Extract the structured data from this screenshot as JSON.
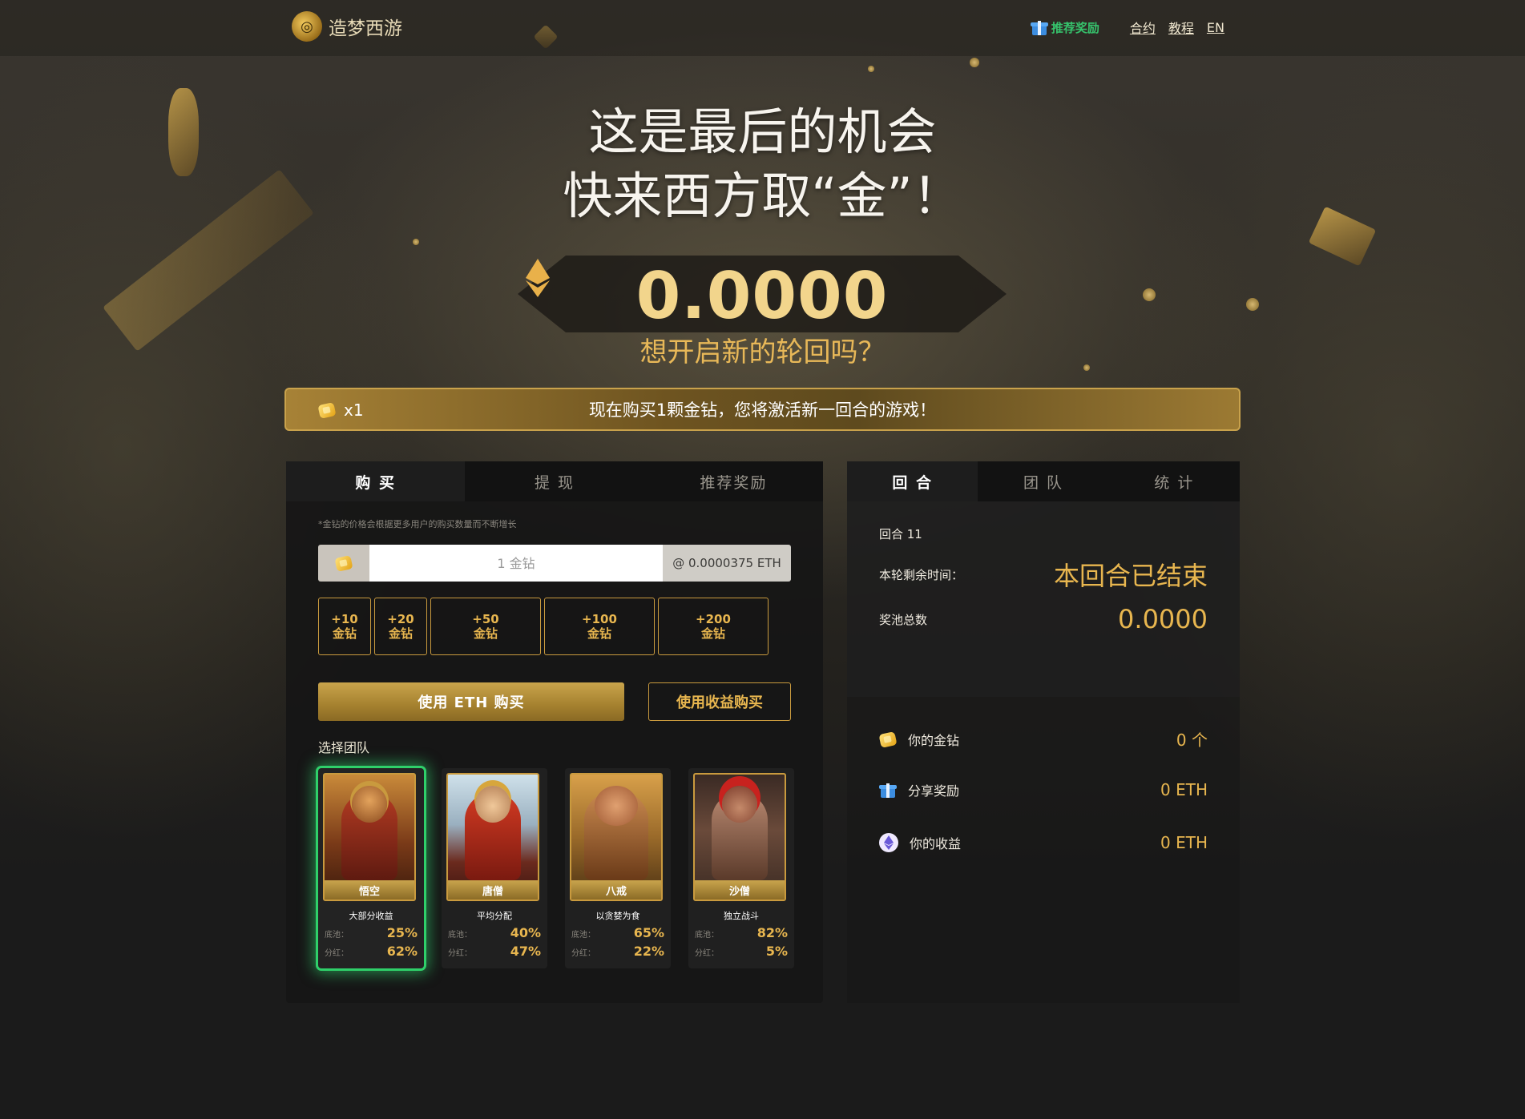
{
  "header": {
    "logo_text": "造梦西游",
    "referral_link": "推荐奖励",
    "nav": [
      "合约",
      "教程",
      "EN"
    ]
  },
  "hero": {
    "line1": "这是最后的机会",
    "line2": "快来西方取“金”！",
    "pot_value": "0.0000",
    "subtitle": "想开启新的轮回吗？"
  },
  "notice_bar": {
    "count": "x1",
    "message": "现在购买1颗金钻，您将激活新一回合的游戏！"
  },
  "left_panel": {
    "tabs": [
      "购 买",
      "提 现",
      "推荐奖励"
    ],
    "active_tab": 0,
    "note": "*金钻的价格会根据更多用户的购买数量而不断增长",
    "input_placeholder": "1 金钻",
    "input_price": "@ 0.0000375 ETH",
    "quick_buttons": [
      {
        "amount": "+10",
        "unit": "金钻"
      },
      {
        "amount": "+20",
        "unit": "金钻"
      },
      {
        "amount": "+50",
        "unit": "金钻"
      },
      {
        "amount": "+100",
        "unit": "金钻"
      },
      {
        "amount": "+200",
        "unit": "金钻"
      }
    ],
    "buy_eth_label": "使用 ETH 购买",
    "buy_earnings_label": "使用收益购买",
    "team_label": "选择团队",
    "teams": [
      {
        "name": "悟空",
        "desc": "大部分收益",
        "pool_label": "底池：",
        "pool": "25%",
        "div_label": "分红：",
        "div": "62%",
        "selected": true
      },
      {
        "name": "唐僧",
        "desc": "平均分配",
        "pool_label": "底池：",
        "pool": "40%",
        "div_label": "分红：",
        "div": "47%",
        "selected": false
      },
      {
        "name": "八戒",
        "desc": "以贪婪为食",
        "pool_label": "底池：",
        "pool": "65%",
        "div_label": "分红：",
        "div": "22%",
        "selected": false
      },
      {
        "name": "沙僧",
        "desc": "独立战斗",
        "pool_label": "底池：",
        "pool": "82%",
        "div_label": "分红：",
        "div": "5%",
        "selected": false
      }
    ]
  },
  "right_panel": {
    "tabs": [
      "回 合",
      "团 队",
      "统 计"
    ],
    "active_tab": 0,
    "round_label": "回合 11",
    "time_label": "本轮剩余时间：",
    "time_value": "本回合已结束",
    "pool_label": "奖池总数",
    "pool_value": "0.0000",
    "stats": [
      {
        "icon": "diamond-icon",
        "label": "你的金钻",
        "value": "0 个"
      },
      {
        "icon": "gift-icon",
        "label": "分享奖励",
        "value": "0 ETH"
      },
      {
        "icon": "eth-icon",
        "label": "你的收益",
        "value": "0 ETH"
      }
    ]
  },
  "colors": {
    "gold": "#e8b64f",
    "gold_border": "#c99a3e",
    "selected_glow": "#2fd06a",
    "referral_green": "#36c26c"
  }
}
